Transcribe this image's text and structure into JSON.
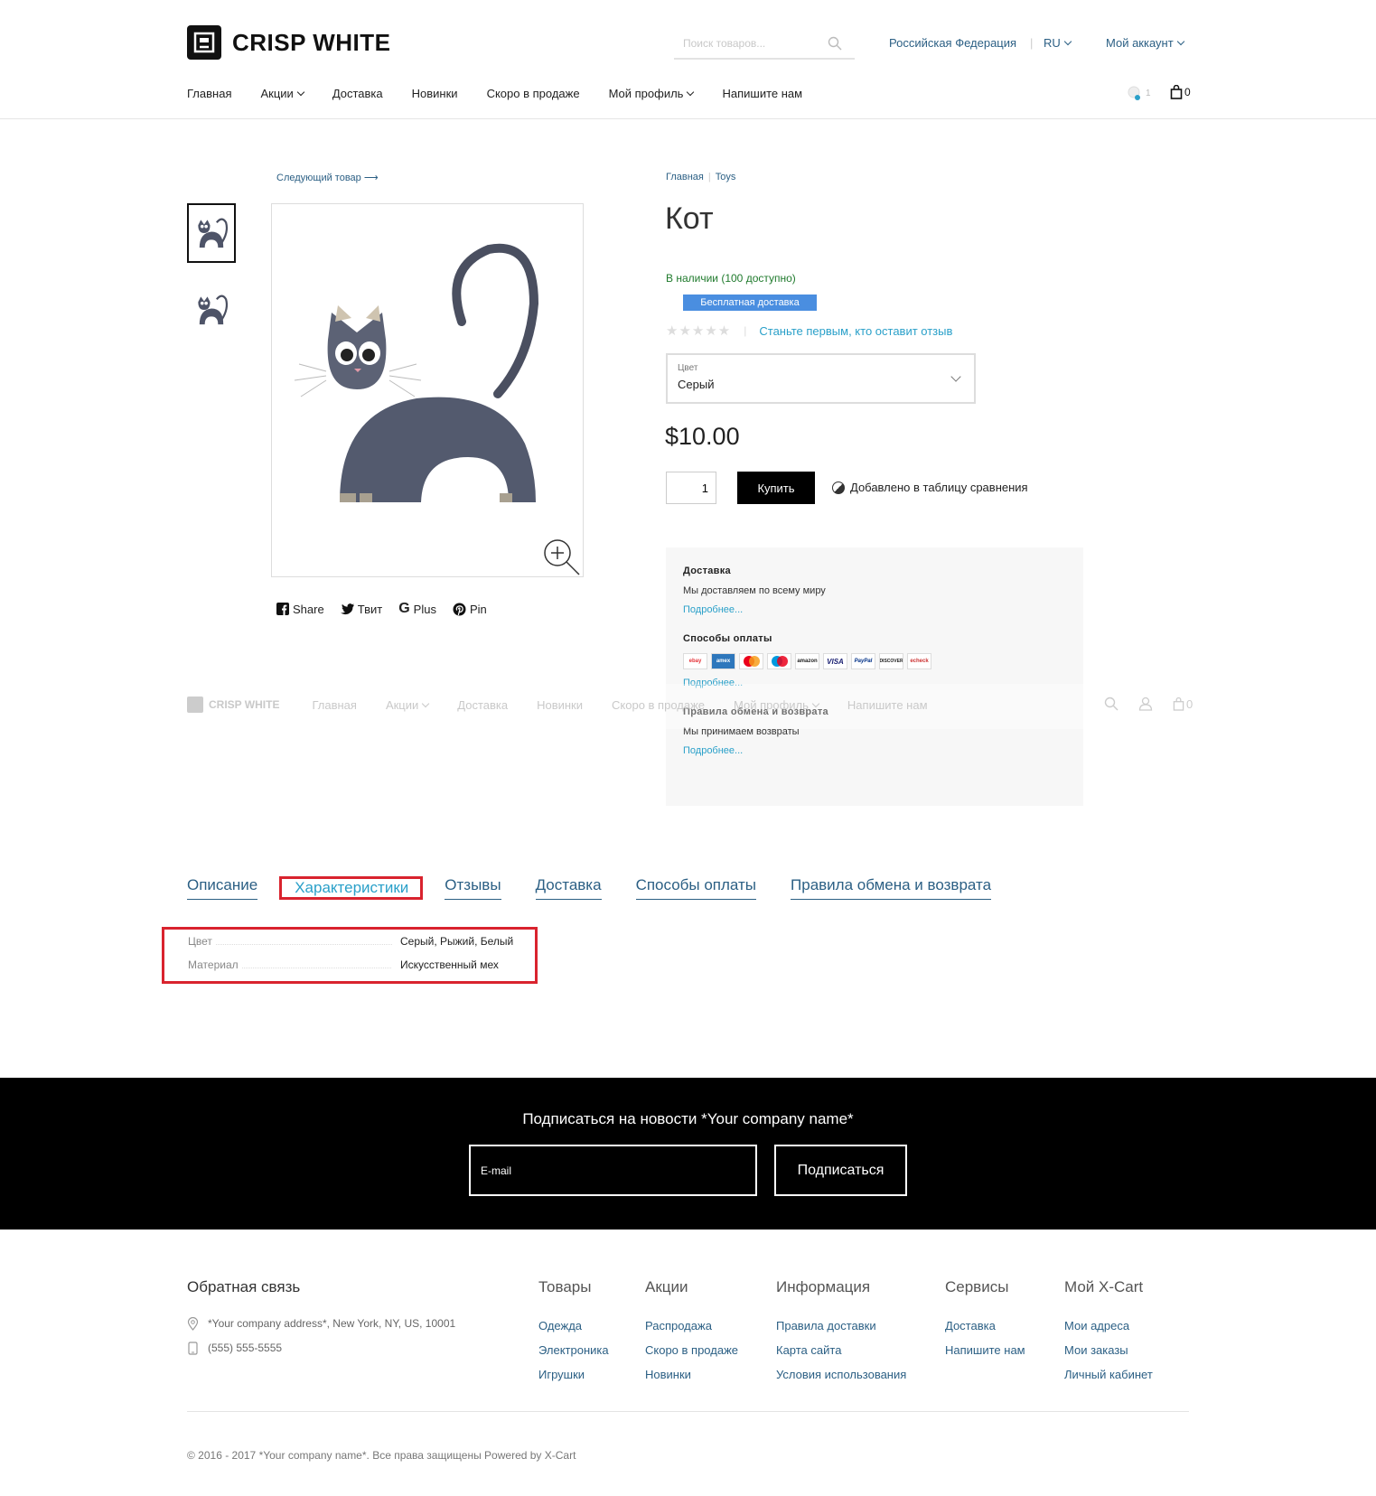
{
  "header": {
    "brand": "CRISP WHITE",
    "search_placeholder": "Поиск товаров...",
    "country": "Российская Федерация",
    "language": "RU",
    "account": "Мой аккаунт",
    "compare_count": "1",
    "cart_count": "0"
  },
  "nav": [
    "Главная",
    "Акции",
    "Доставка",
    "Новинки",
    "Скоро в продаже",
    "Мой профиль",
    "Напишите нам"
  ],
  "gallery": {
    "next_product": "Следующий товар",
    "share": [
      "Share",
      "Твит",
      "Plus",
      "Pin"
    ]
  },
  "product": {
    "breadcrumb": [
      "Главная",
      "Toys"
    ],
    "title": "Кот",
    "stock": "В наличии (100 доступно)",
    "free_shipping": "Бесплатная доставка",
    "rating_link": "Станьте первым, кто оставит отзыв",
    "color_label": "Цвет",
    "color_value": "Серый",
    "price": "$10.00",
    "quantity": "1",
    "buy_label": "Купить",
    "compare_label": "Добавлено в таблицу сравнения"
  },
  "info_box": {
    "shipping_title": "Доставка",
    "shipping_text": "Мы доставляем по всему миру",
    "payment_title": "Способы оплаты",
    "payment_logos": [
      "ebay",
      "amex",
      "mc",
      "maestro",
      "amazon",
      "VISA",
      "PayPal",
      "DISCOVER",
      "echeck"
    ],
    "returns_title": "Правила обмена и возврата",
    "returns_text": "Мы принимаем возвраты",
    "more_label": "Подробнее..."
  },
  "sticky_header": {
    "brand": "CRISP WHITE",
    "items": [
      "Главная",
      "Акции",
      "Доставка",
      "Новинки",
      "Скоро в продаже",
      "Мой профиль",
      "Напишите нам"
    ],
    "cart_count": "0"
  },
  "tabs": [
    "Описание",
    "Характеристики",
    "Отзывы",
    "Доставка",
    "Способы оплаты",
    "Правила обмена и возврата"
  ],
  "attributes": [
    {
      "name": "Цвет",
      "value": "Серый, Рыжий, Белый"
    },
    {
      "name": "Материал",
      "value": "Искусственный мех"
    }
  ],
  "newsletter": {
    "title": "Подписаться на новости *Your company name*",
    "email_placeholder": "E-mail",
    "button": "Подписаться"
  },
  "footer": {
    "contact_title": "Обратная связь",
    "address": "*Your company address*, New York, NY, US, 10001",
    "phone": "(555) 555-5555",
    "columns": [
      {
        "title": "Товары",
        "links": [
          "Одежда",
          "Электроника",
          "Игрушки"
        ]
      },
      {
        "title": "Акции",
        "links": [
          "Распродажа",
          "Скоро в продаже",
          "Новинки"
        ]
      },
      {
        "title": "Информация",
        "links": [
          "Правила доставки",
          "Карта сайта",
          "Условия использования"
        ]
      },
      {
        "title": "Сервисы",
        "links": [
          "Доставка",
          "Напишите нам"
        ]
      },
      {
        "title": "Мой X-Cart",
        "links": [
          "Мои адреса",
          "Мои заказы",
          "Личный кабинет"
        ]
      }
    ],
    "copyright": "© 2016 - 2017 *Your company name*. Все права защищены Powered by X-Cart"
  },
  "colors": {
    "accent_link": "#2aa0c9",
    "link": "#2b5f84",
    "stock_green": "#1f7a2c",
    "badge_blue": "#4a8ee0",
    "highlight_red": "#d9232e"
  }
}
